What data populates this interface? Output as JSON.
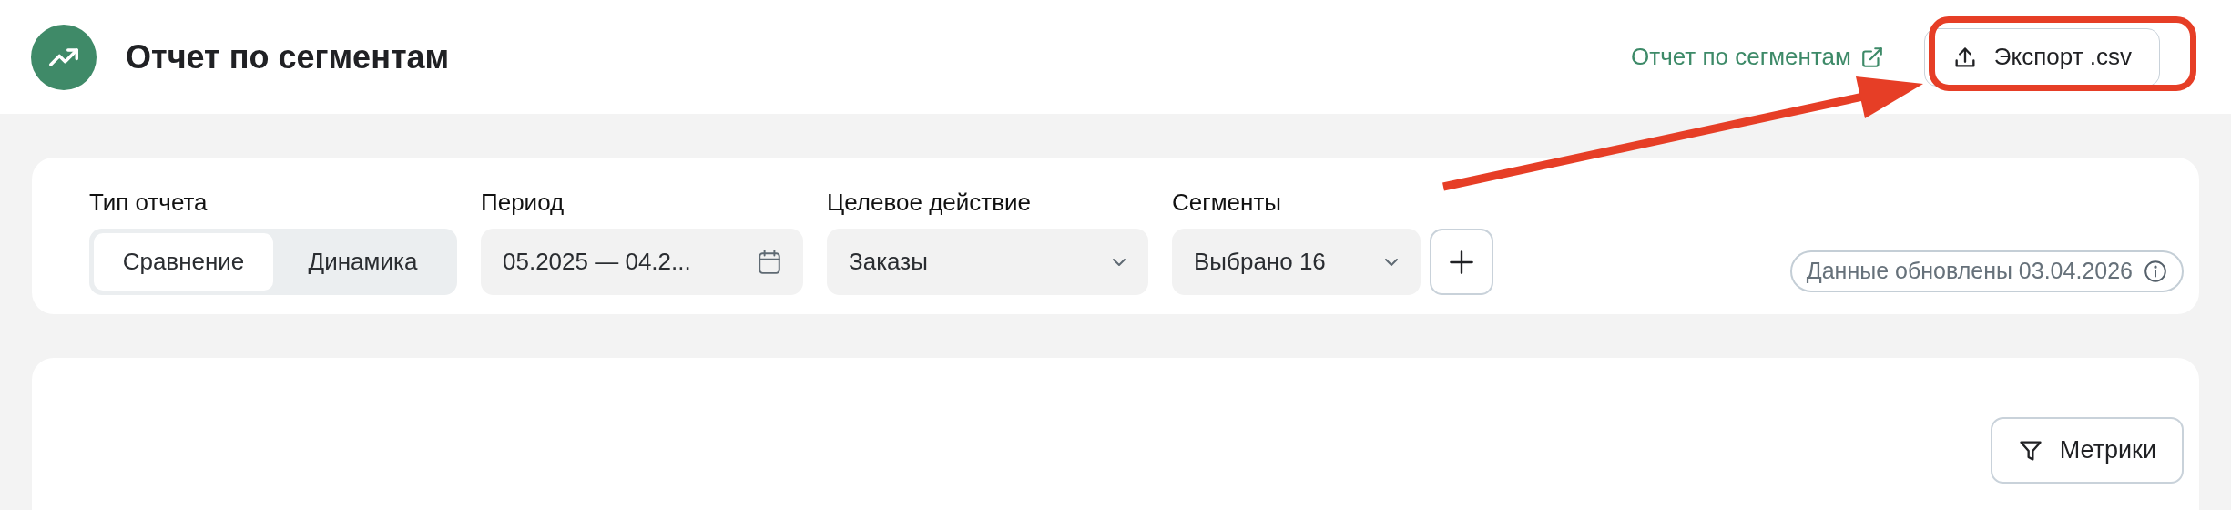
{
  "header": {
    "title": "Отчет по сегментам",
    "link": "Отчет по сегментам",
    "export_button": "Экспорт .csv"
  },
  "filters": [
    {
      "kind": "segmented",
      "label": "Тип отчета",
      "options": [
        {
          "label": "Сравнение",
          "selected": true
        },
        {
          "label": "Динамика",
          "selected": false
        }
      ]
    },
    {
      "kind": "date",
      "label": "Период",
      "value": "05.2025 — 04.2..."
    },
    {
      "kind": "select",
      "label": "Целевое действие",
      "value": "Заказы"
    },
    {
      "kind": "select",
      "label": "Сегменты",
      "value": "Выбрано 16",
      "add": true
    }
  ],
  "updated_badge": "Данные обновлены 03.04.2026",
  "metrics_button": "Метрики"
}
